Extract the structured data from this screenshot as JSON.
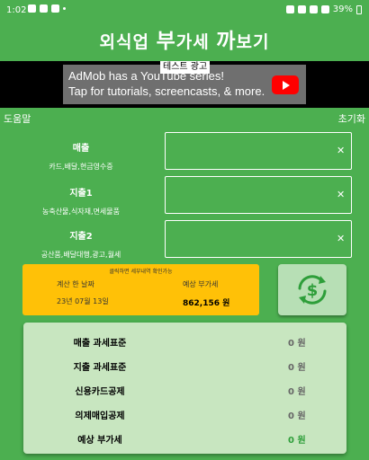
{
  "status": {
    "time": "1:02",
    "battery": "39%"
  },
  "app": {
    "title_pre": "외식업 ",
    "title_big1": "부",
    "title_mid": "가세 ",
    "title_big2": "까",
    "title_post": "보기"
  },
  "ad": {
    "tag": "테스트 광고",
    "line1": "AdMob has a YouTube series!",
    "line2": "Tap for tutorials, screencasts, & more."
  },
  "toolbar": {
    "help": "도움말",
    "reset": "초기화"
  },
  "inputs": [
    {
      "name": "매출",
      "desc": "카드,배달,현금영수증",
      "value": ""
    },
    {
      "name": "지출1",
      "desc": "농축산물,식자재,면세물품",
      "value": ""
    },
    {
      "name": "지출2",
      "desc": "공산품,배달대행,광고,월세",
      "value": ""
    }
  ],
  "result": {
    "hint": "클릭하면 세부내역 확인가능",
    "date_header": "계산 한 날짜",
    "vat_header": "예상 부가세",
    "date_value": "23년 07월 13일",
    "vat_value": "862,156 원"
  },
  "summary": [
    {
      "label": "매출 과세표준",
      "value": "0 원"
    },
    {
      "label": "지출 과세표준",
      "value": "0 원"
    },
    {
      "label": "신용카드공제",
      "value": "0 원"
    },
    {
      "label": "의제매입공제",
      "value": "0 원"
    },
    {
      "label": "예상 부가세",
      "value": "0 원"
    }
  ],
  "colors": {
    "background": "#4caf50",
    "result_card": "#ffc107",
    "summary_card": "#c8e6c0",
    "accent_green": "#2e9e3a"
  },
  "icons": {
    "calculate": "currency-refresh-icon",
    "clear": "close-icon"
  }
}
